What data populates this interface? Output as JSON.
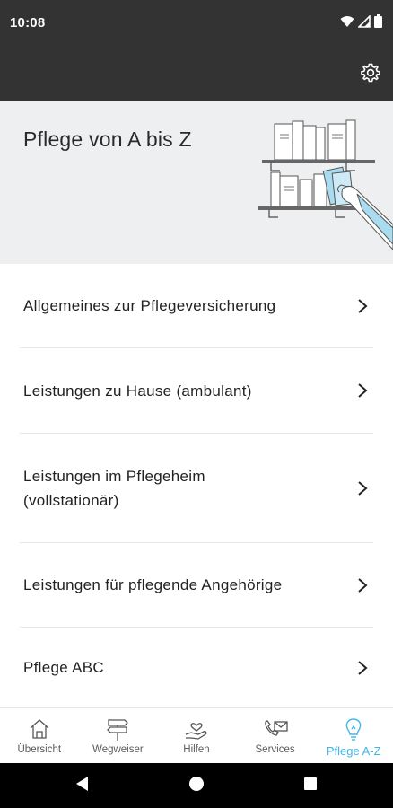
{
  "status_bar": {
    "time": "10:08",
    "icons": [
      "wifi-icon",
      "signal-icon",
      "battery-icon"
    ]
  },
  "app_bar": {
    "settings_icon": "gear-icon"
  },
  "header": {
    "title": "Pflege von A bis Z",
    "illustration": "bookshelf-illustration"
  },
  "topics": [
    {
      "label": "Allgemeines zur Pflegeversicherung"
    },
    {
      "label": "Leistungen zu Hause (ambulant)"
    },
    {
      "label": "Leistungen im Pflegeheim\n(vollstationär)"
    },
    {
      "label": "Leistungen für pflegende Angehörige"
    },
    {
      "label": "Pflege ABC"
    }
  ],
  "bottom_nav": {
    "items": [
      {
        "label": "Übersicht",
        "icon": "house-icon"
      },
      {
        "label": "Wegweiser",
        "icon": "signpost-icon"
      },
      {
        "label": "Hilfen",
        "icon": "hand-heart-icon"
      },
      {
        "label": "Services",
        "icon": "phone-mail-icon"
      },
      {
        "label": "Pflege A-Z",
        "icon": "lightbulb-icon"
      }
    ],
    "active_index": 4
  },
  "colors": {
    "status_bar_bg": "#333333",
    "header_bg": "#eeeff1",
    "accent": "#41b6e6"
  }
}
